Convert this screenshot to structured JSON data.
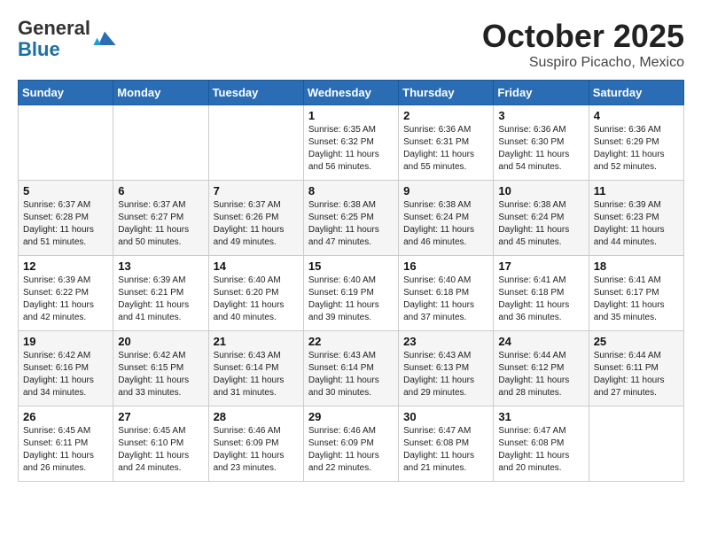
{
  "header": {
    "logo": {
      "line1": "General",
      "line2": "Blue"
    },
    "title": "October 2025",
    "location": "Suspiro Picacho, Mexico"
  },
  "days_of_week": [
    "Sunday",
    "Monday",
    "Tuesday",
    "Wednesday",
    "Thursday",
    "Friday",
    "Saturday"
  ],
  "weeks": [
    [
      {
        "day": "",
        "info": ""
      },
      {
        "day": "",
        "info": ""
      },
      {
        "day": "",
        "info": ""
      },
      {
        "day": "1",
        "info": "Sunrise: 6:35 AM\nSunset: 6:32 PM\nDaylight: 11 hours\nand 56 minutes."
      },
      {
        "day": "2",
        "info": "Sunrise: 6:36 AM\nSunset: 6:31 PM\nDaylight: 11 hours\nand 55 minutes."
      },
      {
        "day": "3",
        "info": "Sunrise: 6:36 AM\nSunset: 6:30 PM\nDaylight: 11 hours\nand 54 minutes."
      },
      {
        "day": "4",
        "info": "Sunrise: 6:36 AM\nSunset: 6:29 PM\nDaylight: 11 hours\nand 52 minutes."
      }
    ],
    [
      {
        "day": "5",
        "info": "Sunrise: 6:37 AM\nSunset: 6:28 PM\nDaylight: 11 hours\nand 51 minutes."
      },
      {
        "day": "6",
        "info": "Sunrise: 6:37 AM\nSunset: 6:27 PM\nDaylight: 11 hours\nand 50 minutes."
      },
      {
        "day": "7",
        "info": "Sunrise: 6:37 AM\nSunset: 6:26 PM\nDaylight: 11 hours\nand 49 minutes."
      },
      {
        "day": "8",
        "info": "Sunrise: 6:38 AM\nSunset: 6:25 PM\nDaylight: 11 hours\nand 47 minutes."
      },
      {
        "day": "9",
        "info": "Sunrise: 6:38 AM\nSunset: 6:24 PM\nDaylight: 11 hours\nand 46 minutes."
      },
      {
        "day": "10",
        "info": "Sunrise: 6:38 AM\nSunset: 6:24 PM\nDaylight: 11 hours\nand 45 minutes."
      },
      {
        "day": "11",
        "info": "Sunrise: 6:39 AM\nSunset: 6:23 PM\nDaylight: 11 hours\nand 44 minutes."
      }
    ],
    [
      {
        "day": "12",
        "info": "Sunrise: 6:39 AM\nSunset: 6:22 PM\nDaylight: 11 hours\nand 42 minutes."
      },
      {
        "day": "13",
        "info": "Sunrise: 6:39 AM\nSunset: 6:21 PM\nDaylight: 11 hours\nand 41 minutes."
      },
      {
        "day": "14",
        "info": "Sunrise: 6:40 AM\nSunset: 6:20 PM\nDaylight: 11 hours\nand 40 minutes."
      },
      {
        "day": "15",
        "info": "Sunrise: 6:40 AM\nSunset: 6:19 PM\nDaylight: 11 hours\nand 39 minutes."
      },
      {
        "day": "16",
        "info": "Sunrise: 6:40 AM\nSunset: 6:18 PM\nDaylight: 11 hours\nand 37 minutes."
      },
      {
        "day": "17",
        "info": "Sunrise: 6:41 AM\nSunset: 6:18 PM\nDaylight: 11 hours\nand 36 minutes."
      },
      {
        "day": "18",
        "info": "Sunrise: 6:41 AM\nSunset: 6:17 PM\nDaylight: 11 hours\nand 35 minutes."
      }
    ],
    [
      {
        "day": "19",
        "info": "Sunrise: 6:42 AM\nSunset: 6:16 PM\nDaylight: 11 hours\nand 34 minutes."
      },
      {
        "day": "20",
        "info": "Sunrise: 6:42 AM\nSunset: 6:15 PM\nDaylight: 11 hours\nand 33 minutes."
      },
      {
        "day": "21",
        "info": "Sunrise: 6:43 AM\nSunset: 6:14 PM\nDaylight: 11 hours\nand 31 minutes."
      },
      {
        "day": "22",
        "info": "Sunrise: 6:43 AM\nSunset: 6:14 PM\nDaylight: 11 hours\nand 30 minutes."
      },
      {
        "day": "23",
        "info": "Sunrise: 6:43 AM\nSunset: 6:13 PM\nDaylight: 11 hours\nand 29 minutes."
      },
      {
        "day": "24",
        "info": "Sunrise: 6:44 AM\nSunset: 6:12 PM\nDaylight: 11 hours\nand 28 minutes."
      },
      {
        "day": "25",
        "info": "Sunrise: 6:44 AM\nSunset: 6:11 PM\nDaylight: 11 hours\nand 27 minutes."
      }
    ],
    [
      {
        "day": "26",
        "info": "Sunrise: 6:45 AM\nSunset: 6:11 PM\nDaylight: 11 hours\nand 26 minutes."
      },
      {
        "day": "27",
        "info": "Sunrise: 6:45 AM\nSunset: 6:10 PM\nDaylight: 11 hours\nand 24 minutes."
      },
      {
        "day": "28",
        "info": "Sunrise: 6:46 AM\nSunset: 6:09 PM\nDaylight: 11 hours\nand 23 minutes."
      },
      {
        "day": "29",
        "info": "Sunrise: 6:46 AM\nSunset: 6:09 PM\nDaylight: 11 hours\nand 22 minutes."
      },
      {
        "day": "30",
        "info": "Sunrise: 6:47 AM\nSunset: 6:08 PM\nDaylight: 11 hours\nand 21 minutes."
      },
      {
        "day": "31",
        "info": "Sunrise: 6:47 AM\nSunset: 6:08 PM\nDaylight: 11 hours\nand 20 minutes."
      },
      {
        "day": "",
        "info": ""
      }
    ]
  ]
}
